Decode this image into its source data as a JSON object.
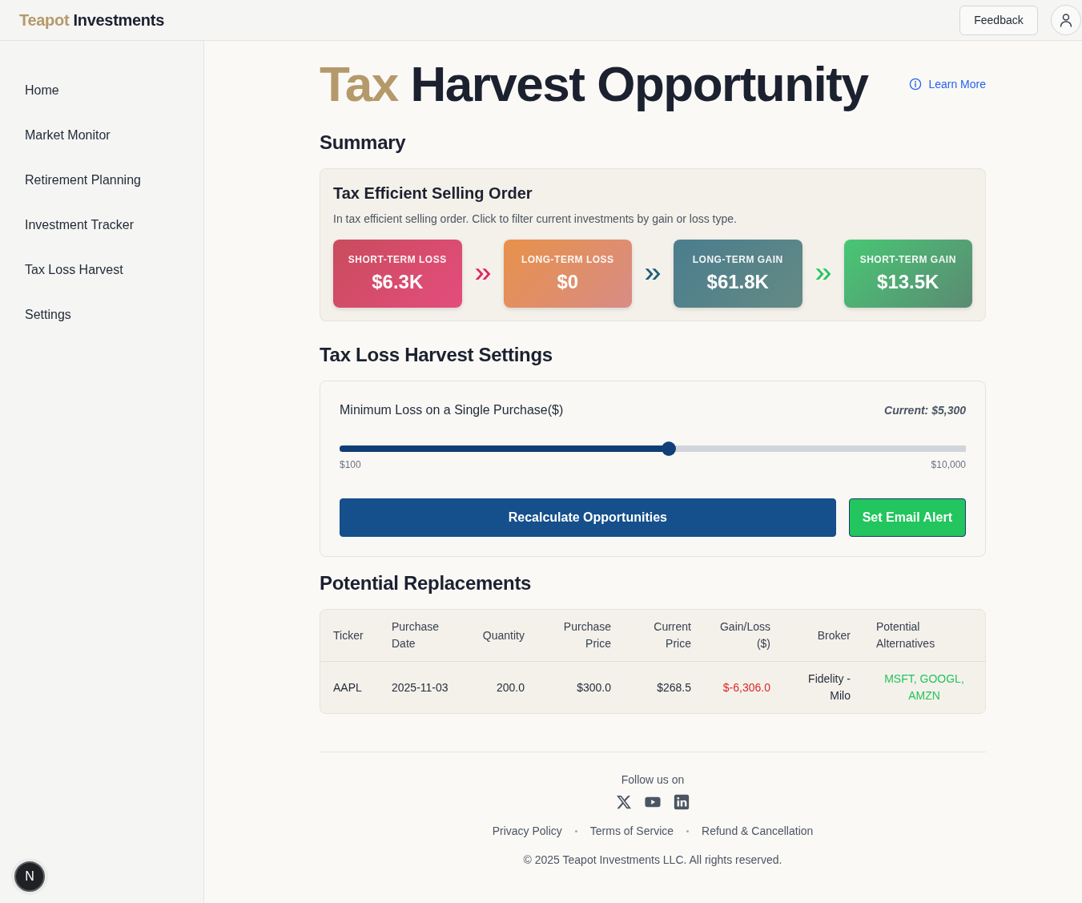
{
  "header": {
    "logo": {
      "accent": "Teapot",
      "name": "Investments"
    },
    "feedback_button": "Feedback"
  },
  "sidebar": {
    "items": [
      {
        "label": "Home"
      },
      {
        "label": "Market Monitor"
      },
      {
        "label": "Retirement Planning"
      },
      {
        "label": "Investment Tracker"
      },
      {
        "label": "Tax Loss Harvest"
      },
      {
        "label": "Settings"
      }
    ]
  },
  "page": {
    "title_accent": "Tax",
    "title": "Harvest Opportunity",
    "learn_more": "Learn More"
  },
  "summary": {
    "heading": "Summary",
    "title": "Tax Efficient Selling Order",
    "description": "In tax efficient selling order. Click to filter current investments by gain or loss type.",
    "tiles": [
      {
        "kind": "short_term_loss",
        "label": "SHORT-TERM LOSS",
        "value": "$6.3K"
      },
      {
        "kind": "long_term_loss",
        "label": "LONG-TERM LOSS",
        "value": "$0"
      },
      {
        "kind": "long_term_gain",
        "label": "LONG-TERM GAIN",
        "value": "$61.8K"
      },
      {
        "kind": "short_term_gain",
        "label": "SHORT-TERM GAIN",
        "value": "$13.5K"
      }
    ],
    "arrows": [
      {
        "color": "#e0245e"
      },
      {
        "color": "#1d5d7a"
      },
      {
        "color": "#22c55e"
      }
    ]
  },
  "settings": {
    "heading": "Tax Loss Harvest Settings",
    "slider": {
      "label": "Minimum Loss on a Single Purchase($)",
      "reading": "Current: $5,300",
      "level": 0.525,
      "min_label": "$100",
      "max_label": "$10,000"
    },
    "buttons": [
      {
        "kind": "primary",
        "label": "Recalculate Opportunities"
      },
      {
        "kind": "success",
        "label": "Set Email Alert"
      }
    ]
  },
  "replacements": {
    "heading": "Potential Replacements",
    "columns": [
      "Ticker",
      "Purchase Date",
      "Quantity",
      "Purchase Price",
      "Current Price",
      "Gain/Loss ($)",
      "Broker",
      "Potential Alternatives"
    ],
    "rows": [
      {
        "cells": [
          {
            "kind": "plain",
            "text": "AAPL"
          },
          {
            "kind": "plain",
            "text": "2025-11-03"
          },
          {
            "kind": "plain",
            "text": "200.0"
          },
          {
            "kind": "plain",
            "text": "$300.0"
          },
          {
            "kind": "plain",
            "text": "$268.5"
          },
          {
            "kind": "loss",
            "text": "$-6,306.0"
          },
          {
            "kind": "plain",
            "text": "Fidelity - Milo"
          },
          {
            "kind": "suggestion",
            "text": "MSFT, GOOGL, AMZN"
          }
        ]
      }
    ]
  },
  "footer": {
    "follow_label": "Follow us on",
    "links": [
      "Privacy Policy",
      "Terms of Service",
      "Refund & Cancellation"
    ],
    "copyright": "© 2025 Teapot Investments LLC. All rights reserved."
  },
  "dev_badge": {
    "label": "N"
  }
}
